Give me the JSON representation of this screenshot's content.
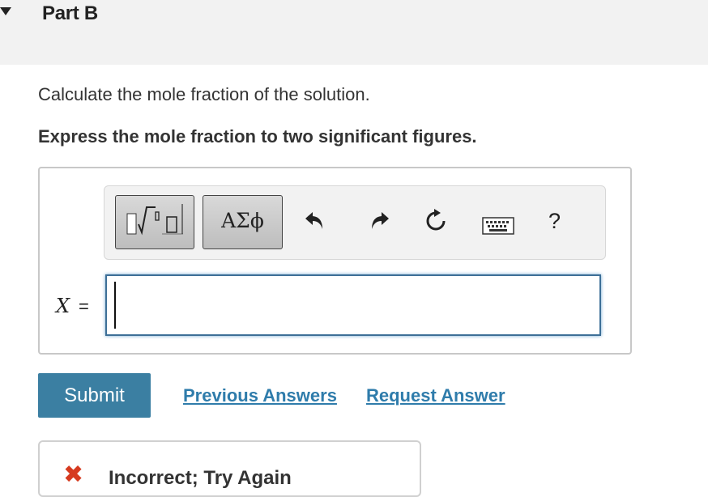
{
  "part": {
    "title": "Part B"
  },
  "question": {
    "text": "Calculate the mole fraction of the solution."
  },
  "instruction": {
    "text": "Express the mole fraction to two significant figures."
  },
  "toolbar": {
    "symbols_label": "ΑΣϕ",
    "icons": [
      "templates-icon",
      "undo-icon",
      "redo-icon",
      "reset-icon",
      "keyboard-icon",
      "help-icon"
    ],
    "help_label": "?"
  },
  "answer": {
    "variable": "X",
    "equals": "=",
    "value": ""
  },
  "actions": {
    "submit_label": "Submit",
    "previous_answers_label": "Previous Answers",
    "request_answer_label": "Request Answer"
  },
  "feedback": {
    "text": "Incorrect; Try Again",
    "icon": "x-mark-icon",
    "color": "#d63a1f"
  },
  "colors": {
    "primary": "#3b7fa2",
    "link": "#2f7cab",
    "input_border": "#3d6f97"
  }
}
